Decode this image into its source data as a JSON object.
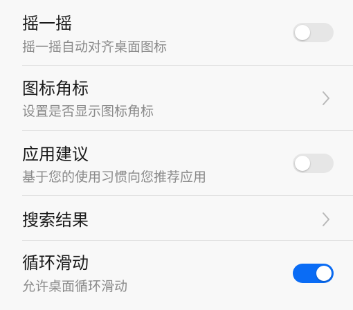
{
  "settings": {
    "items": [
      {
        "title": "摇一摇",
        "subtitle": "摇一摇自动对齐桌面图标",
        "control": "toggle",
        "enabled": false
      },
      {
        "title": "图标角标",
        "subtitle": "设置是否显示图标角标",
        "control": "chevron-right-icon"
      },
      {
        "title": "应用建议",
        "subtitle": "基于您的使用习惯向您推荐应用",
        "control": "toggle",
        "enabled": false
      },
      {
        "title": "搜索结果",
        "control": "chevron-right-icon"
      },
      {
        "title": "循环滑动",
        "subtitle": "允许桌面循环滑动",
        "control": "toggle",
        "enabled": true
      }
    ]
  },
  "colors": {
    "background": "#f8f8f8",
    "toggle_on": "#0a6cf5",
    "toggle_off": "#e6e6e6",
    "title_text": "#1a1a1a",
    "subtitle_text": "#8a8a8a"
  }
}
